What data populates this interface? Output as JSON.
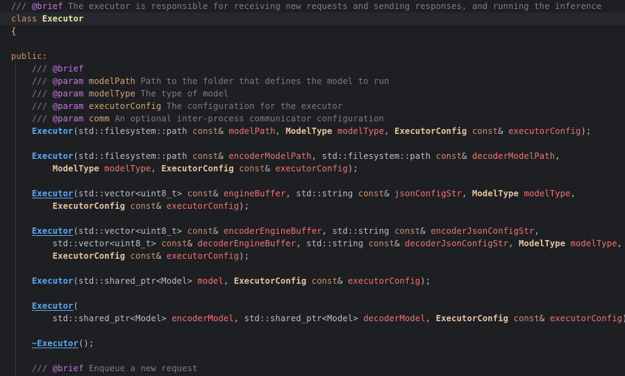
{
  "editor": {
    "lines": [
      [
        {
          "t": "/// ",
          "c": "comment"
        },
        {
          "t": "@brief",
          "c": "doctag"
        },
        {
          "t": " The executor is responsible for receiving new requests and sending responses, and running the inference",
          "c": "comment"
        }
      ],
      [
        {
          "t": "class ",
          "c": "keyword"
        },
        {
          "t": "Executor",
          "c": "class"
        }
      ],
      [
        {
          "t": "{",
          "c": "brace"
        }
      ],
      [],
      [
        {
          "t": "public:",
          "c": "keyword"
        }
      ],
      [
        {
          "t": "    /// ",
          "c": "comment"
        },
        {
          "t": "@brief",
          "c": "doctag"
        }
      ],
      [
        {
          "t": "    /// ",
          "c": "comment"
        },
        {
          "t": "@param",
          "c": "doctag"
        },
        {
          "t": " ",
          "c": "comment"
        },
        {
          "t": "modelPath",
          "c": "docparam"
        },
        {
          "t": " Path to the folder that defines the model to run",
          "c": "comment"
        }
      ],
      [
        {
          "t": "    /// ",
          "c": "comment"
        },
        {
          "t": "@param",
          "c": "doctag"
        },
        {
          "t": " ",
          "c": "comment"
        },
        {
          "t": "modelType",
          "c": "docparam"
        },
        {
          "t": " The type of model",
          "c": "comment"
        }
      ],
      [
        {
          "t": "    /// ",
          "c": "comment"
        },
        {
          "t": "@param",
          "c": "doctag"
        },
        {
          "t": " ",
          "c": "comment"
        },
        {
          "t": "executorConfig",
          "c": "docparam"
        },
        {
          "t": " The configuration for the executor",
          "c": "comment"
        }
      ],
      [
        {
          "t": "    /// ",
          "c": "comment"
        },
        {
          "t": "@param",
          "c": "doctag"
        },
        {
          "t": " ",
          "c": "comment"
        },
        {
          "t": "comm",
          "c": "docparam"
        },
        {
          "t": " An optional inter-process communicator configuration",
          "c": "comment"
        }
      ],
      [
        {
          "t": "    ",
          "c": "plain"
        },
        {
          "t": "Executor",
          "c": "func"
        },
        {
          "t": "(",
          "c": "punc"
        },
        {
          "t": "std::filesystem::path",
          "c": "ns"
        },
        {
          "t": " ",
          "c": "plain"
        },
        {
          "t": "const",
          "c": "keyword"
        },
        {
          "t": "& ",
          "c": "punc"
        },
        {
          "t": "modelPath",
          "c": "param"
        },
        {
          "t": ", ",
          "c": "punc"
        },
        {
          "t": "ModelType",
          "c": "type"
        },
        {
          "t": " ",
          "c": "plain"
        },
        {
          "t": "modelType",
          "c": "param"
        },
        {
          "t": ", ",
          "c": "punc"
        },
        {
          "t": "ExecutorConfig",
          "c": "type"
        },
        {
          "t": " ",
          "c": "plain"
        },
        {
          "t": "const",
          "c": "keyword"
        },
        {
          "t": "& ",
          "c": "punc"
        },
        {
          "t": "executorConfig",
          "c": "param"
        },
        {
          "t": ");",
          "c": "punc"
        }
      ],
      [],
      [
        {
          "t": "    ",
          "c": "plain"
        },
        {
          "t": "Executor",
          "c": "func"
        },
        {
          "t": "(",
          "c": "punc"
        },
        {
          "t": "std::filesystem::path",
          "c": "ns"
        },
        {
          "t": " ",
          "c": "plain"
        },
        {
          "t": "const",
          "c": "keyword"
        },
        {
          "t": "& ",
          "c": "punc"
        },
        {
          "t": "encoderModelPath",
          "c": "param"
        },
        {
          "t": ", ",
          "c": "punc"
        },
        {
          "t": "std::filesystem::path",
          "c": "ns"
        },
        {
          "t": " ",
          "c": "plain"
        },
        {
          "t": "const",
          "c": "keyword"
        },
        {
          "t": "& ",
          "c": "punc"
        },
        {
          "t": "decoderModelPath",
          "c": "param"
        },
        {
          "t": ",",
          "c": "punc"
        }
      ],
      [
        {
          "t": "        ",
          "c": "plain"
        },
        {
          "t": "ModelType",
          "c": "type"
        },
        {
          "t": " ",
          "c": "plain"
        },
        {
          "t": "modelType",
          "c": "param"
        },
        {
          "t": ", ",
          "c": "punc"
        },
        {
          "t": "ExecutorConfig",
          "c": "type"
        },
        {
          "t": " ",
          "c": "plain"
        },
        {
          "t": "const",
          "c": "keyword"
        },
        {
          "t": "& ",
          "c": "punc"
        },
        {
          "t": "executorConfig",
          "c": "param"
        },
        {
          "t": ");",
          "c": "punc"
        }
      ],
      [],
      [
        {
          "t": "    ",
          "c": "plain"
        },
        {
          "t": "Executor",
          "c": "func underline"
        },
        {
          "t": "(",
          "c": "punc"
        },
        {
          "t": "std::vector<uint8_t>",
          "c": "ns"
        },
        {
          "t": " ",
          "c": "plain"
        },
        {
          "t": "const",
          "c": "keyword"
        },
        {
          "t": "& ",
          "c": "punc"
        },
        {
          "t": "engineBuffer",
          "c": "param"
        },
        {
          "t": ", ",
          "c": "punc"
        },
        {
          "t": "std::string",
          "c": "ns"
        },
        {
          "t": " ",
          "c": "plain"
        },
        {
          "t": "const",
          "c": "keyword"
        },
        {
          "t": "& ",
          "c": "punc"
        },
        {
          "t": "jsonConfigStr",
          "c": "param"
        },
        {
          "t": ", ",
          "c": "punc"
        },
        {
          "t": "ModelType",
          "c": "type"
        },
        {
          "t": " ",
          "c": "plain"
        },
        {
          "t": "modelType",
          "c": "param"
        },
        {
          "t": ",",
          "c": "punc"
        }
      ],
      [
        {
          "t": "        ",
          "c": "plain"
        },
        {
          "t": "ExecutorConfig",
          "c": "type"
        },
        {
          "t": " ",
          "c": "plain"
        },
        {
          "t": "const",
          "c": "keyword"
        },
        {
          "t": "& ",
          "c": "punc"
        },
        {
          "t": "executorConfig",
          "c": "param"
        },
        {
          "t": ");",
          "c": "punc"
        }
      ],
      [],
      [
        {
          "t": "    ",
          "c": "plain"
        },
        {
          "t": "Executor",
          "c": "func underline"
        },
        {
          "t": "(",
          "c": "punc"
        },
        {
          "t": "std::vector<uint8_t>",
          "c": "ns"
        },
        {
          "t": " ",
          "c": "plain"
        },
        {
          "t": "const",
          "c": "keyword"
        },
        {
          "t": "& ",
          "c": "punc"
        },
        {
          "t": "encoderEngineBuffer",
          "c": "param"
        },
        {
          "t": ", ",
          "c": "punc"
        },
        {
          "t": "std::string",
          "c": "ns"
        },
        {
          "t": " ",
          "c": "plain"
        },
        {
          "t": "const",
          "c": "keyword"
        },
        {
          "t": "& ",
          "c": "punc"
        },
        {
          "t": "encoderJsonConfigStr",
          "c": "param"
        },
        {
          "t": ",",
          "c": "punc"
        }
      ],
      [
        {
          "t": "        ",
          "c": "plain"
        },
        {
          "t": "std::vector<uint8_t>",
          "c": "ns"
        },
        {
          "t": " ",
          "c": "plain"
        },
        {
          "t": "const",
          "c": "keyword"
        },
        {
          "t": "& ",
          "c": "punc"
        },
        {
          "t": "decoderEngineBuffer",
          "c": "param"
        },
        {
          "t": ", ",
          "c": "punc"
        },
        {
          "t": "std::string",
          "c": "ns"
        },
        {
          "t": " ",
          "c": "plain"
        },
        {
          "t": "const",
          "c": "keyword"
        },
        {
          "t": "& ",
          "c": "punc"
        },
        {
          "t": "decoderJsonConfigStr",
          "c": "param"
        },
        {
          "t": ", ",
          "c": "punc"
        },
        {
          "t": "ModelType",
          "c": "type"
        },
        {
          "t": " ",
          "c": "plain"
        },
        {
          "t": "modelType",
          "c": "param"
        },
        {
          "t": ",",
          "c": "punc"
        }
      ],
      [
        {
          "t": "        ",
          "c": "plain"
        },
        {
          "t": "ExecutorConfig",
          "c": "type"
        },
        {
          "t": " ",
          "c": "plain"
        },
        {
          "t": "const",
          "c": "keyword"
        },
        {
          "t": "& ",
          "c": "punc"
        },
        {
          "t": "executorConfig",
          "c": "param"
        },
        {
          "t": ");",
          "c": "punc"
        }
      ],
      [],
      [
        {
          "t": "    ",
          "c": "plain"
        },
        {
          "t": "Executor",
          "c": "func"
        },
        {
          "t": "(",
          "c": "punc"
        },
        {
          "t": "std::shared_ptr<Model>",
          "c": "ns"
        },
        {
          "t": " ",
          "c": "plain"
        },
        {
          "t": "model",
          "c": "param"
        },
        {
          "t": ", ",
          "c": "punc"
        },
        {
          "t": "ExecutorConfig",
          "c": "type"
        },
        {
          "t": " ",
          "c": "plain"
        },
        {
          "t": "const",
          "c": "keyword"
        },
        {
          "t": "& ",
          "c": "punc"
        },
        {
          "t": "executorConfig",
          "c": "param"
        },
        {
          "t": ");",
          "c": "punc"
        }
      ],
      [],
      [
        {
          "t": "    ",
          "c": "plain"
        },
        {
          "t": "Executor",
          "c": "func underline"
        },
        {
          "t": "(",
          "c": "punc"
        }
      ],
      [
        {
          "t": "        ",
          "c": "plain"
        },
        {
          "t": "std::shared_ptr<Model>",
          "c": "ns"
        },
        {
          "t": " ",
          "c": "plain"
        },
        {
          "t": "encoderModel",
          "c": "param"
        },
        {
          "t": ", ",
          "c": "punc"
        },
        {
          "t": "std::shared_ptr<Model>",
          "c": "ns"
        },
        {
          "t": " ",
          "c": "plain"
        },
        {
          "t": "decoderModel",
          "c": "param"
        },
        {
          "t": ", ",
          "c": "punc"
        },
        {
          "t": "ExecutorConfig",
          "c": "type"
        },
        {
          "t": " ",
          "c": "plain"
        },
        {
          "t": "const",
          "c": "keyword"
        },
        {
          "t": "& ",
          "c": "punc"
        },
        {
          "t": "executorConfig",
          "c": "param"
        },
        {
          "t": ");",
          "c": "punc"
        }
      ],
      [],
      [
        {
          "t": "    ",
          "c": "plain"
        },
        {
          "t": "~Executor",
          "c": "func underline"
        },
        {
          "t": "();",
          "c": "punc"
        }
      ],
      [],
      [
        {
          "t": "    /// ",
          "c": "comment"
        },
        {
          "t": "@brief",
          "c": "doctag"
        },
        {
          "t": " Enqueue a new request",
          "c": "comment"
        }
      ]
    ],
    "current_line": 1,
    "colors": {
      "background": "#1e1f22",
      "current_line": "#26282e",
      "comment": "#7a7e85",
      "doctag": "#c678dd",
      "keyword": "#cf8e6d",
      "function": "#58a9f7",
      "parameter": "#ef7373",
      "type": "#e6c4a0"
    }
  }
}
